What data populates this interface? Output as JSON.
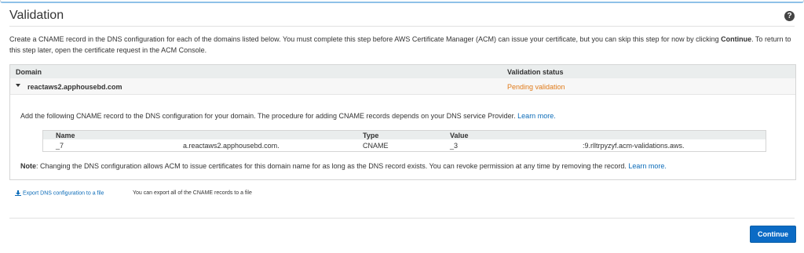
{
  "section": {
    "title": "Validation",
    "help_icon": "question-circle-icon",
    "intro_part1": "Create a CNAME record in the DNS configuration for each of the domains listed below. You must complete this step before AWS Certificate Manager (ACM) can issue your certificate, but you can skip this step for now by clicking ",
    "intro_bold": "Continue",
    "intro_part2": ". To return to this step later, open the certificate request in the ACM Console."
  },
  "table": {
    "headers": {
      "domain": "Domain",
      "status": "Validation status"
    },
    "row": {
      "domain": "reactaws2.apphousebd.com",
      "status": "Pending validation",
      "status_color": "#e07b1a",
      "instruction": "Add the following CNAME record to the DNS configuration for your domain. The procedure for adding CNAME records depends on your DNS service Provider.",
      "learn_more": "Learn more.",
      "cname": {
        "headers": {
          "name": "Name",
          "type": "Type",
          "value": "Value"
        },
        "name_prefix": "_7",
        "name_suffix": "a.reactaws2.apphousebd.com.",
        "type": "CNAME",
        "value_prefix": "_3",
        "value_suffix": ":9.rlltrpyzyf.acm-validations.aws."
      },
      "note_label": "Note",
      "note_text": ": Changing the DNS configuration allows ACM to issue certificates for this domain name for as long as the DNS record exists. You can revoke permission at any time by removing the record.",
      "note_learn_more": "Learn more."
    }
  },
  "export": {
    "link": "Export DNS configuration to a file",
    "note": "You can export all of the CNAME records to a file"
  },
  "actions": {
    "continue": "Continue",
    "primary_color": "#0b6bc5"
  }
}
